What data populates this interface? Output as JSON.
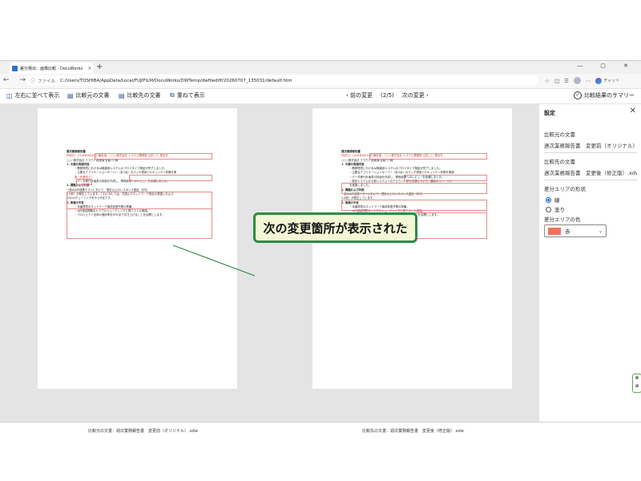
{
  "browser": {
    "tab_title": "差分検出：画像比較 - DocuWorks",
    "tab_close": "×",
    "new_tab": "+",
    "window_controls": "— ▢ ✕",
    "nav_icons": "← → ↻",
    "url_prefix": "ファイル",
    "url": "C:/Users/TOSHIBA/AppData/Local/FUJIFILM/DocuWorks/DWTemp/dwfilediff/20260707_135031/default.htm",
    "chat_label": "チャット"
  },
  "toolbar": {
    "side_by_side": "左右に並べて表示",
    "source_doc": "比較元の文書",
    "target_doc": "比較先の文書",
    "overlay": "重ねて表示",
    "prev_change": "前の変更",
    "page_indicator": "(2/5)",
    "next_change": "次の変更",
    "summary": "比較結果のサマリー"
  },
  "left_doc": {
    "title": "週次業務報告書",
    "line1": "作成日：2026年8月10日 報告者：○○○株式会社 システム開発部 山田 ○○ 提出先",
    "line2": "○○○株式会社 クラウド推進課 佐藤○○様",
    "h1": "1. 今週の実施内容",
    "b1": "・開発環境におけるAI機能部システムのプロトタイプ検証が完了しました。",
    "b2": "・主要なアプリケーションサーバー（計2台）のパッチ適用とセキュリティ診断を実",
    "b2b": "施（作業完了）",
    "b3": "・データ移行計画書の初版を作成し、関係部署へのレビューを依頼しました。",
    "h2": "2. 課題および対策",
    "c1": "一部のAPI連携テストにおいて、想定以上のレスポンス遅延（平均",
    "c2": "2.5秒）が発生しています。これに対しては、先週よりネットワーク設定の見直しおよび",
    "c3": "SQLのチューニングを行う予定です。",
    "h3": "3. 来週の予定",
    "d1": "・本番環境のネットワーク構成変更作業の準備。",
    "d2": "・API遅延問題のトラブルシューティングと再テストの実施。",
    "d3": "・プロジェクト全体の進捗率を80%まで引き上げることを目標とします。",
    "caption": "比較元の文書：週次業務報告書　変更前（オリジナル）.xdw"
  },
  "right_doc": {
    "title": "週次業務報告書",
    "line1": "作成日：2026年8月13日 報告者：○○○株式会社 システム開発部 山田 ○○ 提出先",
    "line2": "○○○株式会社 クラウド推進課 佐藤○○様",
    "h1": "1. 今週の実施内容",
    "b1": "・開発環境におけるAI機能部システムのプロトタイプ検証が完了しました。",
    "b2": "・主要なアプリケーションサーバー（計3台）のパッチ適用とセキュリティ診断を実施",
    "b3": "・データ移行計画書の初版を作成し、関係部署へのレビューを依頼しました。",
    "b4": "・既存システムから新システムへのアカウント移行手順について、臨時のリハーサル",
    "b4b": "を実施しました。",
    "h2": "2. 課題および対策",
    "c1": "一部のAPI連携テストにおいて、想定以上のレスポンス遅延（平均",
    "c2": "3.8秒）が発生しています。",
    "h3": "3. 来週の予定",
    "d1": "・本番環境のネットワーク構成変更作業の準備。",
    "d2": "・API遅延問題のトラブルシューティングと再テストの実施。",
    "d3": "・プロジェクト全体の進捗率を90%まで引き上げることを目標とします。",
    "caption": "比較先の文書：週次業務報告書　変更後（修正版）.xdw"
  },
  "panel": {
    "title": "設定",
    "close": "✕",
    "source_label": "比較元の文書",
    "source_value": "週次業務報告書　変更前（オリジナル）.xdw",
    "target_label": "比較先の文書",
    "target_value": "週次業務報告書　変更後（修正版）.xdw",
    "shape_label": "差分エリアの形状",
    "shape_line": "線",
    "shape_fill": "塗り",
    "color_label": "差分エリアの色",
    "color_value": "赤",
    "color_hex": "#f07060",
    "chevron": "⌄"
  },
  "callout": {
    "text": "次の変更箇所が表示された"
  },
  "colors": {
    "highlight": "#e58a8a",
    "callout_border": "#2e8b45",
    "callout_bg": "#f3f7d6",
    "radio_selected": "#1a66c9"
  }
}
